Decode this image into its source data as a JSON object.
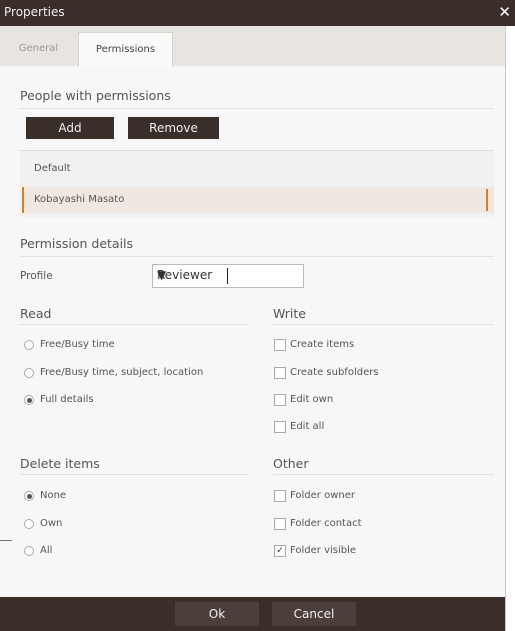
{
  "window": {
    "title": "Properties",
    "close_glyph": "✕"
  },
  "tabs": [
    {
      "label": "General"
    },
    {
      "label": "Permissions"
    }
  ],
  "people": {
    "heading": "People with permissions",
    "add_label": "Add",
    "remove_label": "Remove",
    "list_header": "Default",
    "selected_user": "Kobayashi Masato"
  },
  "details": {
    "heading": "Permission details",
    "profile_label": "Profile",
    "profile_value": "Reviewer"
  },
  "read": {
    "heading": "Read",
    "options": [
      {
        "label": "Free/Busy time",
        "selected": false
      },
      {
        "label": "Free/Busy time, subject, location",
        "selected": false
      },
      {
        "label": "Full details",
        "selected": true
      }
    ]
  },
  "write": {
    "heading": "Write",
    "options": [
      {
        "label": "Create items",
        "checked": false
      },
      {
        "label": "Create subfolders",
        "checked": false
      },
      {
        "label": "Edit own",
        "checked": false
      },
      {
        "label": "Edit all",
        "checked": false
      }
    ]
  },
  "delete": {
    "heading": "Delete items",
    "options": [
      {
        "label": "None",
        "selected": true
      },
      {
        "label": "Own",
        "selected": false
      },
      {
        "label": "All",
        "selected": false
      }
    ]
  },
  "other": {
    "heading": "Other",
    "options": [
      {
        "label": "Folder owner",
        "checked": false
      },
      {
        "label": "Folder contact",
        "checked": false
      },
      {
        "label": "Folder visible",
        "checked": true
      }
    ]
  },
  "footer": {
    "ok_label": "Ok",
    "cancel_label": "Cancel"
  },
  "colors": {
    "titlebar": "#3a2e2b",
    "accent": "#d97b2e"
  }
}
